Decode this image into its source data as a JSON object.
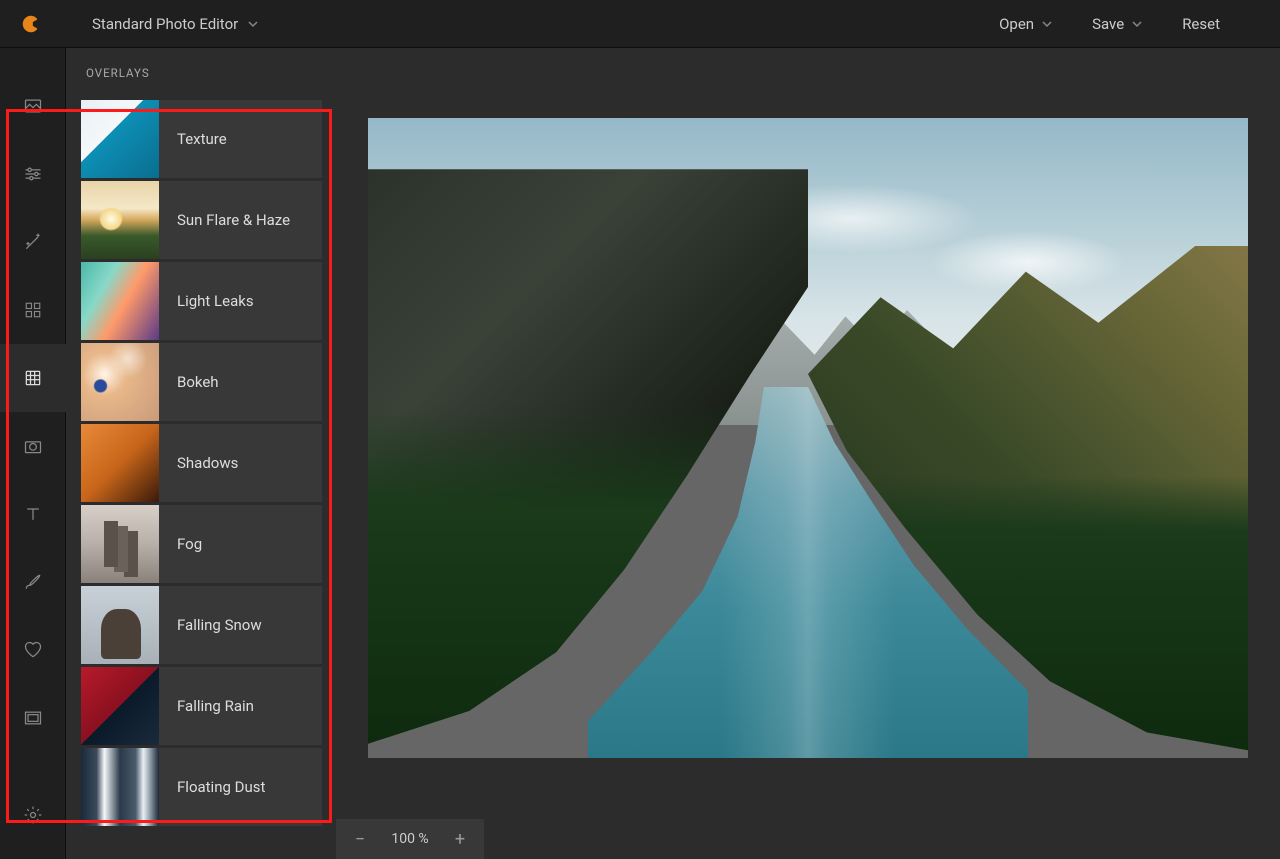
{
  "header": {
    "title": "Standard Photo Editor",
    "actions": {
      "open": "Open",
      "save": "Save",
      "reset": "Reset"
    }
  },
  "toolstrip": {
    "items": [
      {
        "name": "image-tool",
        "active": false
      },
      {
        "name": "adjust-tool",
        "active": false
      },
      {
        "name": "effects-tool",
        "active": false
      },
      {
        "name": "elements-tool",
        "active": false
      },
      {
        "name": "overlays-tool",
        "active": true
      },
      {
        "name": "crop-tool",
        "active": false
      },
      {
        "name": "text-tool",
        "active": false
      },
      {
        "name": "draw-tool",
        "active": false
      },
      {
        "name": "favorites-tool",
        "active": false
      },
      {
        "name": "frames-tool",
        "active": false
      },
      {
        "name": "settings-tool",
        "active": false
      }
    ]
  },
  "panel": {
    "title": "OVERLAYS",
    "items": [
      {
        "label": "Texture",
        "thumb": "th-texture"
      },
      {
        "label": "Sun Flare & Haze",
        "thumb": "th-sunflare"
      },
      {
        "label": "Light Leaks",
        "thumb": "th-lightleaks"
      },
      {
        "label": "Bokeh",
        "thumb": "th-bokeh"
      },
      {
        "label": "Shadows",
        "thumb": "th-shadows"
      },
      {
        "label": "Fog",
        "thumb": "th-fog"
      },
      {
        "label": "Falling Snow",
        "thumb": "th-snow"
      },
      {
        "label": "Falling Rain",
        "thumb": "th-rain"
      },
      {
        "label": "Floating Dust",
        "thumb": "th-dust"
      }
    ]
  },
  "zoom": {
    "value": "100 %"
  }
}
